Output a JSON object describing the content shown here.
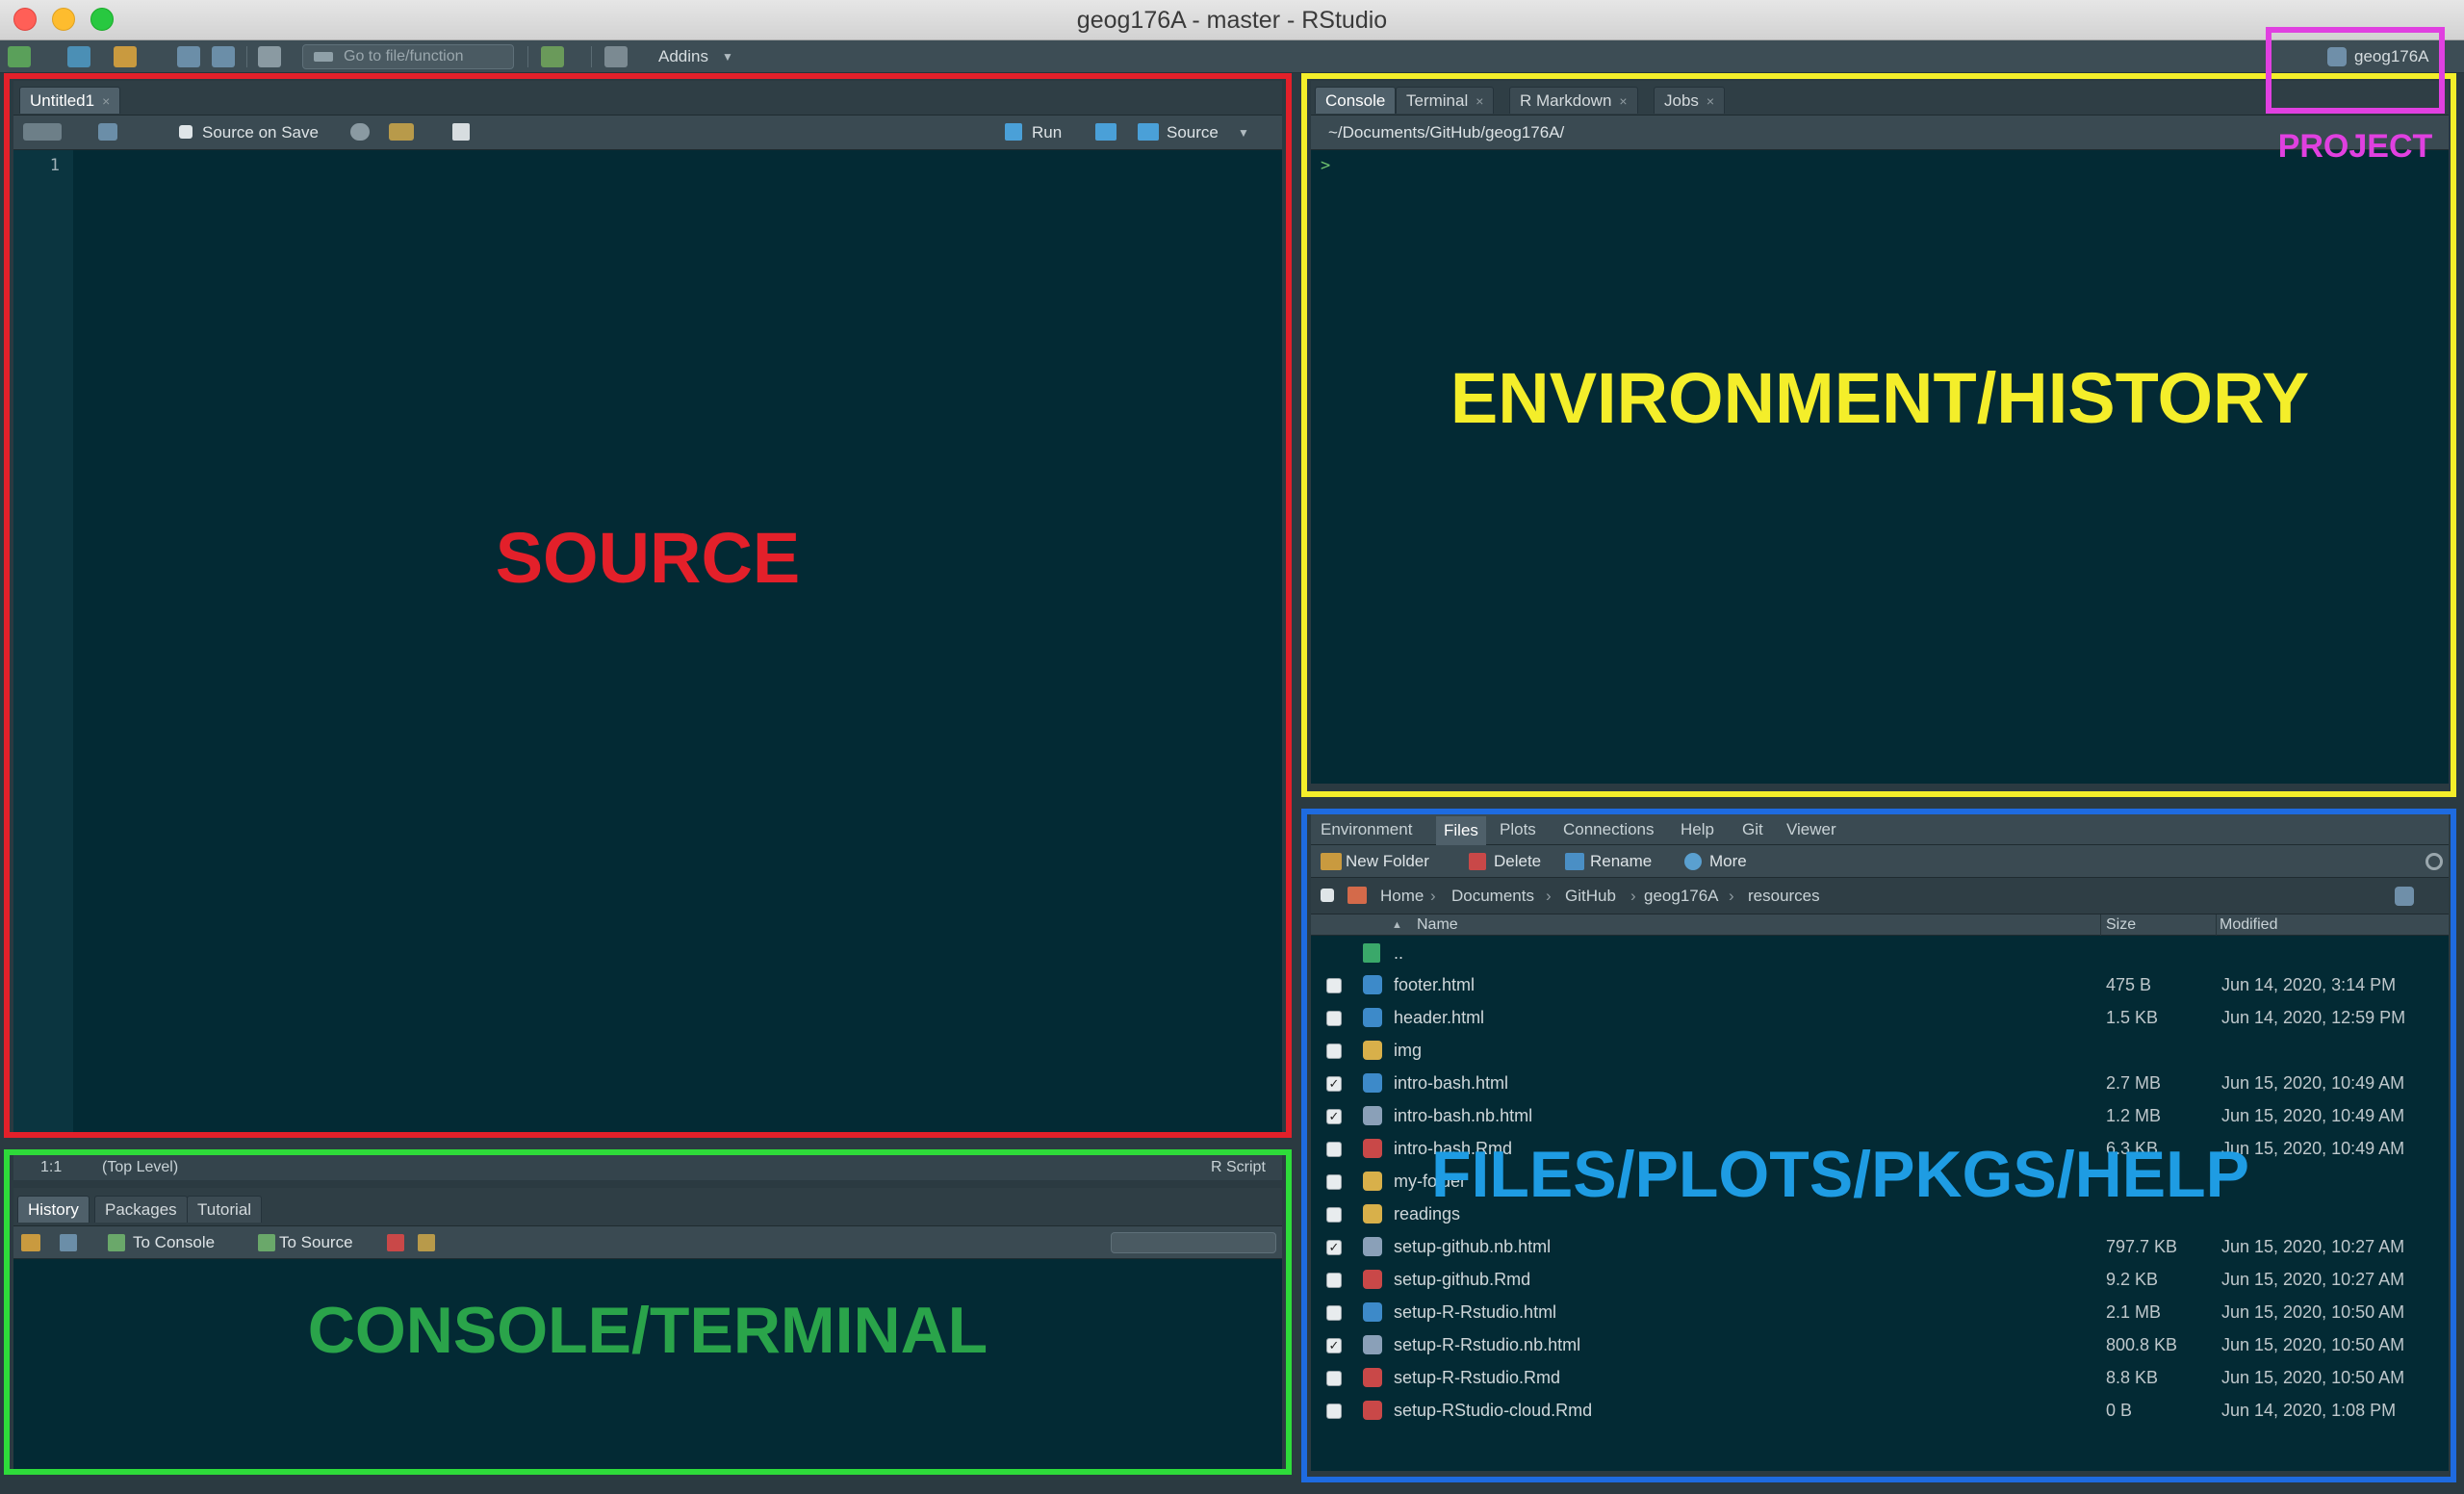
{
  "window": {
    "title": "geog176A - master - RStudio"
  },
  "toolbar": {
    "goto_placeholder": "Go to file/function",
    "addins": "Addins",
    "project": "geog176A"
  },
  "source_pane": {
    "tab": "Untitled1",
    "source_on_save": "Source on Save",
    "run": "Run",
    "source": "Source",
    "line_number": "1",
    "status_position": "1:1",
    "status_scope": "(Top Level)",
    "status_type": "R Script"
  },
  "console_pane": {
    "tabs": [
      "Console",
      "Terminal",
      "R Markdown",
      "Jobs"
    ],
    "path": "~/Documents/GitHub/geog176A/",
    "prompt": ">"
  },
  "history_pane": {
    "tabs": [
      "History",
      "Packages",
      "Tutorial"
    ],
    "to_console": "To Console",
    "to_source": "To Source"
  },
  "files_pane": {
    "tabs": [
      "Environment",
      "Files",
      "Plots",
      "Connections",
      "Help",
      "Git",
      "Viewer"
    ],
    "actions": {
      "new_folder": "New Folder",
      "delete": "Delete",
      "rename": "Rename",
      "more": "More"
    },
    "breadcrumb": [
      "Home",
      "Documents",
      "GitHub",
      "geog176A",
      "resources"
    ],
    "columns": {
      "name": "Name",
      "size": "Size",
      "modified": "Modified"
    },
    "up": "..",
    "files": [
      {
        "name": "footer.html",
        "size": "475 B",
        "modified": "Jun 14, 2020, 3:14 PM",
        "checked": false,
        "kind": "html"
      },
      {
        "name": "header.html",
        "size": "1.5 KB",
        "modified": "Jun 14, 2020, 12:59 PM",
        "checked": false,
        "kind": "html"
      },
      {
        "name": "img",
        "size": "",
        "modified": "",
        "checked": false,
        "kind": "folder"
      },
      {
        "name": "intro-bash.html",
        "size": "2.7 MB",
        "modified": "Jun 15, 2020, 10:49 AM",
        "checked": true,
        "kind": "html"
      },
      {
        "name": "intro-bash.nb.html",
        "size": "1.2 MB",
        "modified": "Jun 15, 2020, 10:49 AM",
        "checked": true,
        "kind": "nb"
      },
      {
        "name": "intro-bash.Rmd",
        "size": "6.3 KB",
        "modified": "Jun 15, 2020, 10:49 AM",
        "checked": false,
        "kind": "rmd"
      },
      {
        "name": "my-folder",
        "size": "",
        "modified": "",
        "checked": false,
        "kind": "folder"
      },
      {
        "name": "readings",
        "size": "",
        "modified": "",
        "checked": false,
        "kind": "folder"
      },
      {
        "name": "setup-github.nb.html",
        "size": "797.7 KB",
        "modified": "Jun 15, 2020, 10:27 AM",
        "checked": true,
        "kind": "nb"
      },
      {
        "name": "setup-github.Rmd",
        "size": "9.2 KB",
        "modified": "Jun 15, 2020, 10:27 AM",
        "checked": false,
        "kind": "rmd"
      },
      {
        "name": "setup-R-Rstudio.html",
        "size": "2.1 MB",
        "modified": "Jun 15, 2020, 10:50 AM",
        "checked": false,
        "kind": "html"
      },
      {
        "name": "setup-R-Rstudio.nb.html",
        "size": "800.8 KB",
        "modified": "Jun 15, 2020, 10:50 AM",
        "checked": true,
        "kind": "nb"
      },
      {
        "name": "setup-R-Rstudio.Rmd",
        "size": "8.8 KB",
        "modified": "Jun 15, 2020, 10:50 AM",
        "checked": false,
        "kind": "rmd"
      },
      {
        "name": "setup-RStudio-cloud.Rmd",
        "size": "0 B",
        "modified": "Jun 14, 2020, 1:08 PM",
        "checked": false,
        "kind": "rmd"
      }
    ]
  },
  "annotations": {
    "source": "SOURCE",
    "env_history": "ENVIRONMENT/HISTORY",
    "console_terminal": "CONSOLE/TERMINAL",
    "files": "FILES/PLOTS/PKGS/HELP",
    "project": "PROJECT"
  },
  "colors": {
    "source": "#e3202a",
    "env": "#f4ee2a",
    "console": "#2edb3a",
    "files": "#1e6be0",
    "project": "#e040e0",
    "files_label": "#1e9ce3",
    "console_label": "#2aa44a"
  }
}
